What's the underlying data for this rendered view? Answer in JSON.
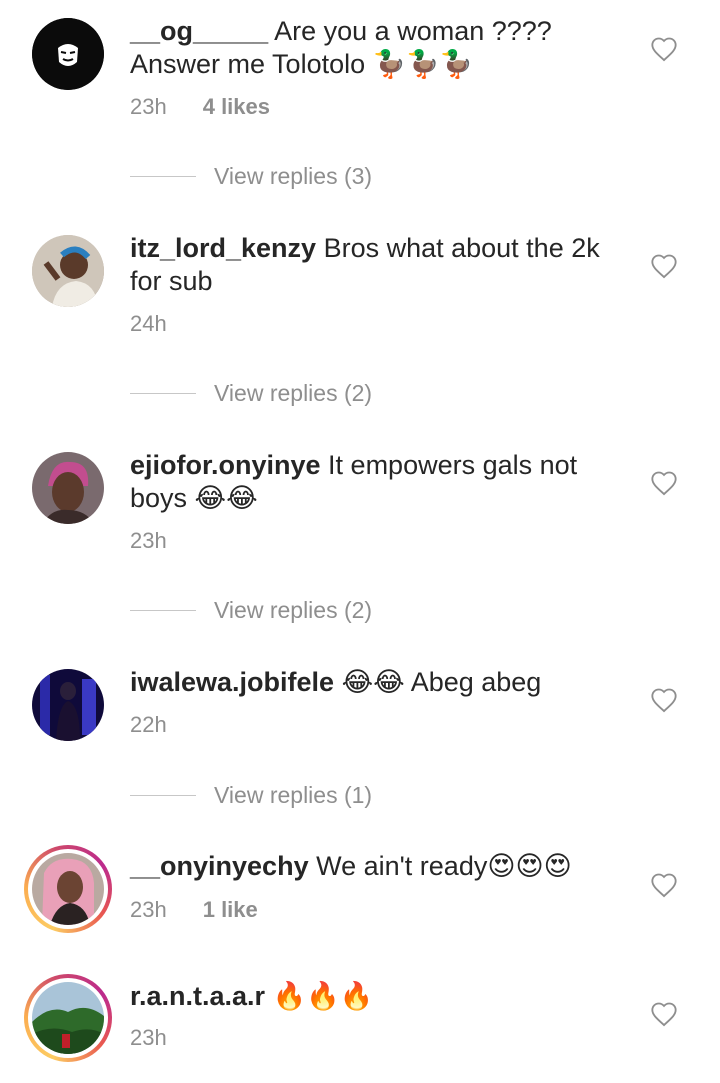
{
  "comments": [
    {
      "username": "__og_____",
      "text": " Are you a woman ???? Answer me Tolotolo 🦆🦆🦆",
      "time": "23h",
      "likes": "4 likes",
      "replies": "View replies (3)"
    },
    {
      "username": "itz_lord_kenzy",
      "text": " Bros what about the 2k for sub",
      "time": "24h",
      "likes": "",
      "replies": "View replies (2)"
    },
    {
      "username": "ejiofor.onyinye",
      "text": " It empowers gals not boys 😂😂",
      "time": "23h",
      "likes": "",
      "replies": "View replies (2)"
    },
    {
      "username": "iwalewa.jobifele",
      "text": " 😂😂 Abeg abeg",
      "time": "22h",
      "likes": "",
      "replies": "View replies (1)"
    },
    {
      "username": "__onyinyechy",
      "text": " We ain't ready😍😍😍",
      "time": "23h",
      "likes": "1 like",
      "replies": ""
    },
    {
      "username": "r.a.n.t.a.a.r",
      "text": " 🔥🔥🔥",
      "time": "23h",
      "likes": "",
      "replies": ""
    }
  ],
  "colors": {
    "text": "#262626",
    "muted": "#8e8e8e",
    "story_ring": [
      "#fccc63",
      "#cd486b",
      "#bc2a8d"
    ]
  },
  "icons": {
    "like": "heart-outline-icon"
  }
}
